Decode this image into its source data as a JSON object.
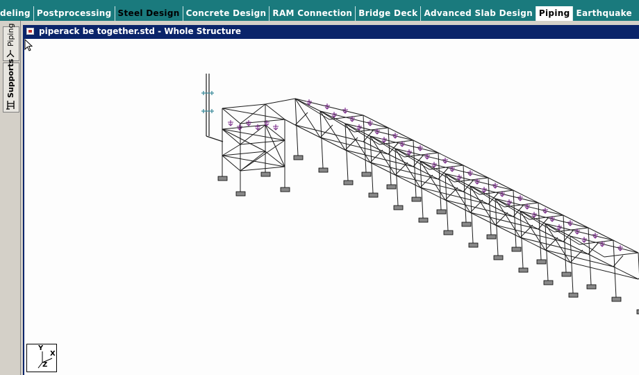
{
  "ribbon": {
    "tabs": [
      {
        "label": "deling",
        "state": "normal"
      },
      {
        "label": "Postprocessing",
        "state": "normal"
      },
      {
        "label": "Steel Design",
        "state": "dark"
      },
      {
        "label": "Concrete Design",
        "state": "normal"
      },
      {
        "label": "RAM Connection",
        "state": "normal"
      },
      {
        "label": "Bridge Deck",
        "state": "normal"
      },
      {
        "label": "Advanced Slab Design",
        "state": "normal"
      },
      {
        "label": "Piping",
        "state": "active"
      },
      {
        "label": "Earthquake",
        "state": "normal"
      }
    ],
    "colors": {
      "bar": "#1a7a7d",
      "active_tab": "#ffffff"
    }
  },
  "sidebar": {
    "tabs": [
      {
        "label": "Piping",
        "icon": "piping-icon"
      },
      {
        "label": "Supports",
        "icon": "supports-icon"
      }
    ]
  },
  "window": {
    "title": "piperack be together.std - Whole Structure",
    "colors": {
      "titlebar": "#0a246a",
      "canvas": "#fdfdfd",
      "structure": "#1a1a1a",
      "loads": "#7a2a8a",
      "pipe_supports": "#3a8a9a"
    }
  },
  "view": {
    "axis_labels": {
      "x": "X",
      "y": "Y",
      "z": "Z"
    },
    "cursor_icon": "arrow-cursor-icon"
  }
}
